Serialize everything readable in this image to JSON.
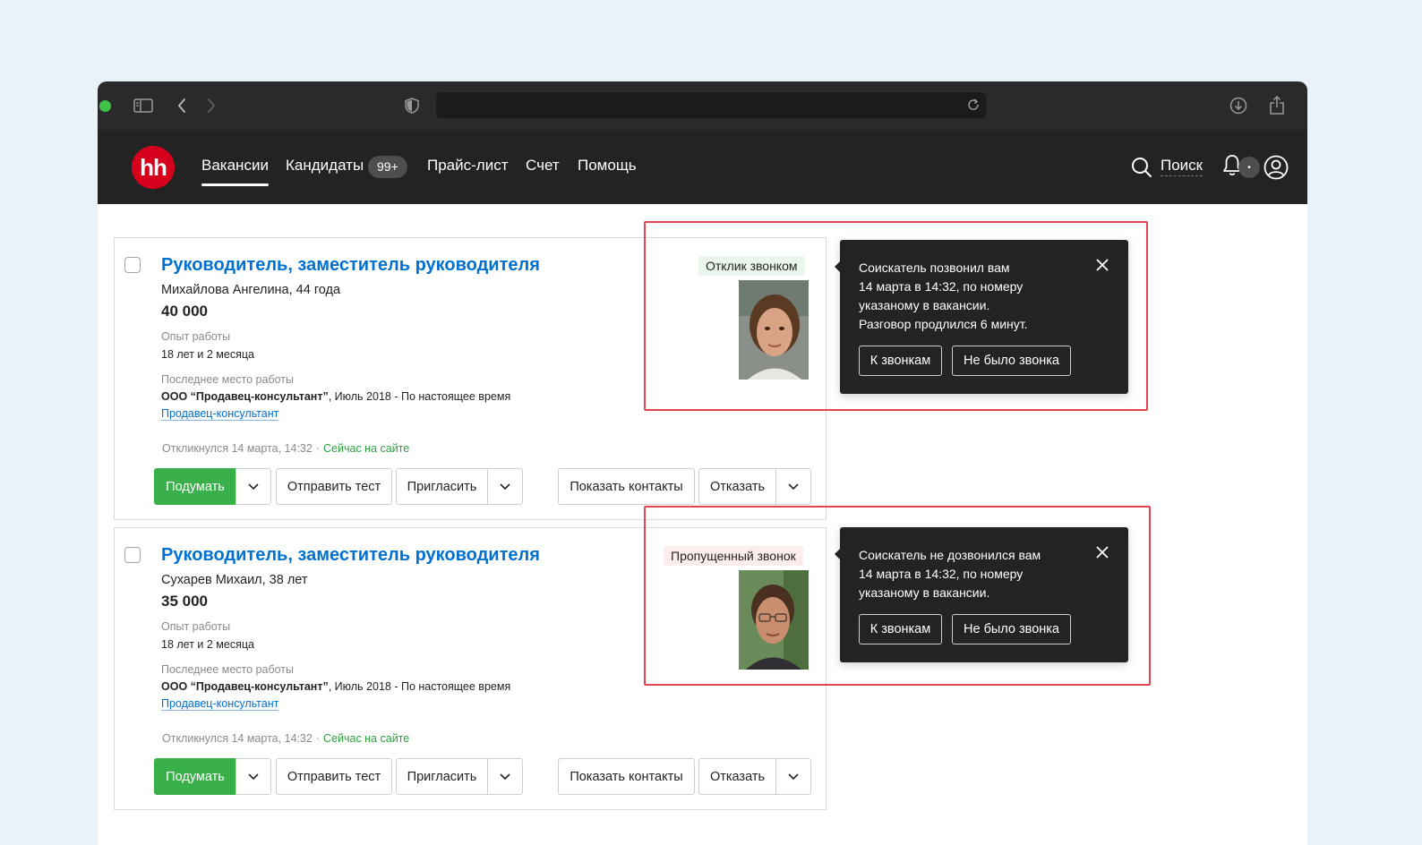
{
  "browser": {
    "icons": [
      "sidebar-icon",
      "back-icon",
      "forward-icon",
      "shield-icon",
      "reload-icon",
      "download-icon",
      "share-icon"
    ]
  },
  "nav": {
    "logo": "hh",
    "items": [
      "Вакансии",
      "Кандидаты",
      "Прайс-лист",
      "Счет",
      "Помощь"
    ],
    "candidates_badge": "99+",
    "search_label": "Поиск",
    "notifications_badge": "•"
  },
  "cards": [
    {
      "title": "Руководитель, заместитель руководителя",
      "name": "Михайлова Ангелина, 44 года",
      "salary": "40 000",
      "experience_label": "Опыт работы",
      "experience": "18 лет и 2 месяца",
      "last_job_label": "Последнее место работы",
      "company": "ООО “Продавец-консультант”",
      "period": ", Июль 2018 - По настоящее время",
      "position": "Продавец-консультант",
      "responded": "Откликнулся 14 марта, 14:32",
      "online": "Сейчас на сайте",
      "tag": "Отклик звонком",
      "buttons": {
        "think": "Подумать",
        "send_test": "Отправить тест",
        "invite": "Пригласить",
        "show_contacts": "Показать контакты",
        "reject": "Отказать"
      }
    },
    {
      "title": "Руководитель, заместитель руководителя",
      "name": "Сухарев Михаил, 38 лет",
      "salary": "35 000",
      "experience_label": "Опыт работы",
      "experience": "18 лет и 2 месяца",
      "last_job_label": "Последнее место работы",
      "company": "ООО “Продавец-консультант”",
      "period": ", Июль 2018 - По настоящее время",
      "position": "Продавец-консультант",
      "responded": "Откликнулся 14 марта, 14:32",
      "online": "Сейчас на сайте",
      "tag": "Пропущенный звонок",
      "buttons": {
        "think": "Подумать",
        "send_test": "Отправить тест",
        "invite": "Пригласить",
        "show_contacts": "Показать контакты",
        "reject": "Отказать"
      }
    }
  ],
  "tooltips": [
    {
      "lines": [
        "Соискатель позвонил вам",
        "14 марта в 14:32, по номеру",
        "указаному в вакансии.",
        "Разговор продлился 6 минут."
      ],
      "to_calls": "К звонкам",
      "no_call": "Не было звонка"
    },
    {
      "lines": [
        "Соискатель не дозвонился вам",
        "14 марта в 14:32, по номеру",
        "указаному в вакансии."
      ],
      "to_calls": "К звонкам",
      "no_call": "Не было звонка"
    }
  ],
  "colors": {
    "brand": "#d6001c",
    "link": "#0070d1",
    "primary_button": "#3ab04a",
    "highlight": "#e0464d"
  }
}
